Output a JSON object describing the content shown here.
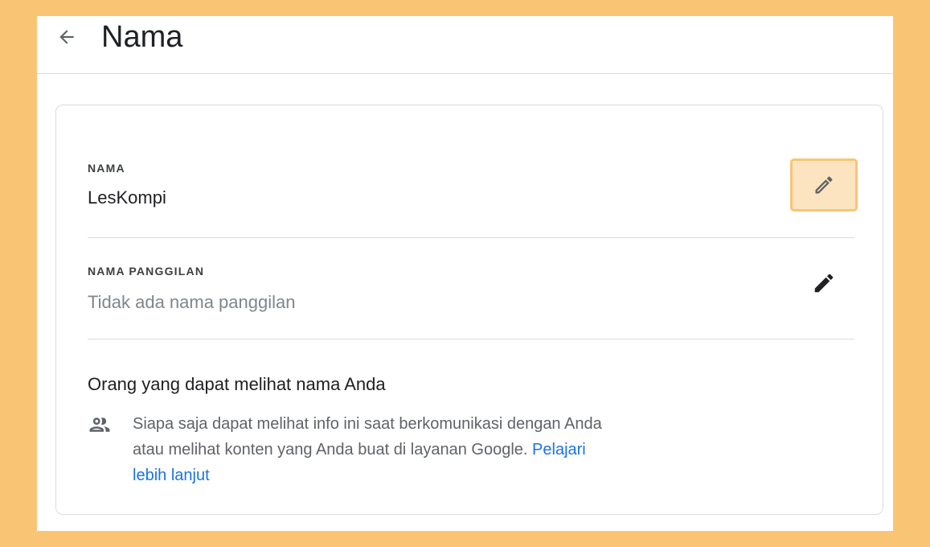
{
  "header": {
    "title": "Nama",
    "back_icon": "arrow-back-icon"
  },
  "fields": {
    "name": {
      "label": "NAMA",
      "value": "LesKompi",
      "edit_icon": "pencil-icon"
    },
    "nickname": {
      "label": "NAMA PANGGILAN",
      "placeholder": "Tidak ada nama panggilan",
      "edit_icon": "pencil-icon"
    }
  },
  "visibility": {
    "title": "Orang yang dapat melihat nama Anda",
    "icon": "people-icon",
    "description": "Siapa saja dapat melihat info ini saat berkomunikasi dengan Anda atau melihat konten yang Anda buat di layanan Google.",
    "link_label": "Pelajari lebih lanjut"
  },
  "colors": {
    "background": "#f9c574",
    "highlight": "#fde4c0",
    "link": "#1a73e8"
  }
}
